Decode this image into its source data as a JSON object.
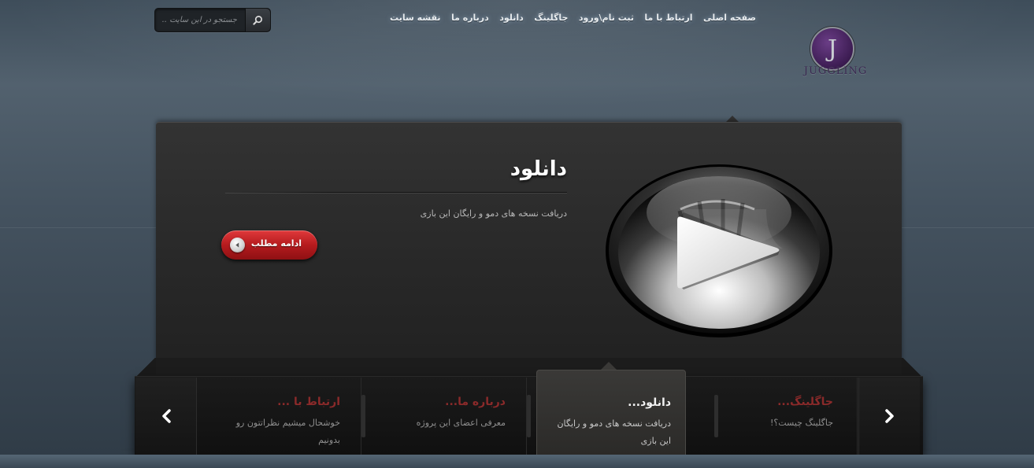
{
  "search": {
    "placeholder": "جستجو در این سایت ..."
  },
  "nav": {
    "items": [
      {
        "label": "صفحه اصلی"
      },
      {
        "label": "ارتباط با ما"
      },
      {
        "label": "ثبت نام\\ورود"
      },
      {
        "label": "جاگلینگ"
      },
      {
        "label": "دانلود"
      },
      {
        "label": "درباره ما"
      },
      {
        "label": "نقشه سایت"
      }
    ]
  },
  "logo": {
    "letter": "J",
    "text": "JUGGLING"
  },
  "slide": {
    "title": "دانلود",
    "description": "دریافت نسخه های دمو و رایگان این بازی",
    "more_label": "ادامه مطلب",
    "graphic_icon": "play-icon"
  },
  "tabs": [
    {
      "title": "جاگلینگ...",
      "description": "جاگلینگ چیست؟!",
      "active": false
    },
    {
      "title": "دانلود...",
      "description": "دریافت نسخه های دمو و رایگان این بازی",
      "active": true
    },
    {
      "title": "درباره ما...",
      "description": "معرفی اعضای این پروژه",
      "active": false
    },
    {
      "title": "ارتباط با ...",
      "description": "خوشحال میشیم نظراتتون رو بدونیم",
      "active": false
    }
  ],
  "colors": {
    "accent_red": "#c4262a",
    "inactive_tab_title": "#8b2a2a"
  }
}
